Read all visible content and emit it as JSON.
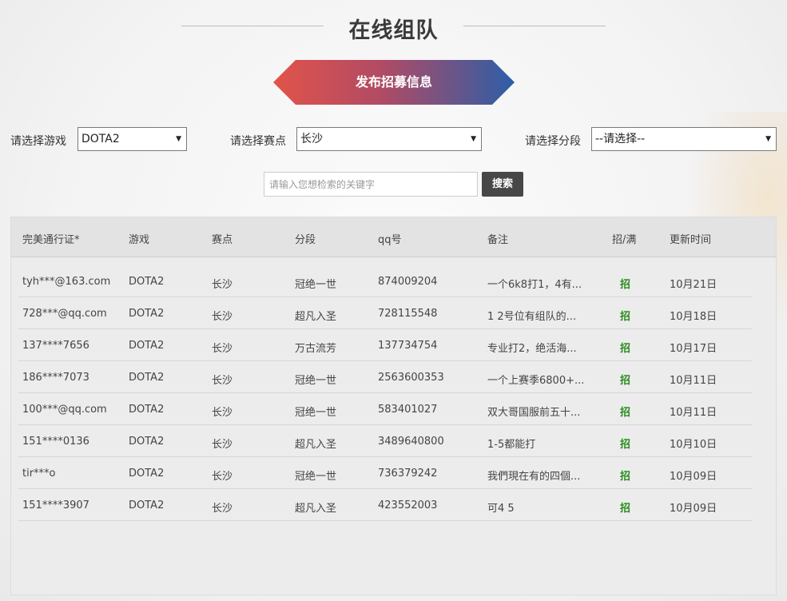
{
  "header": {
    "title": "在线组队"
  },
  "publish_button": {
    "label": "发布招募信息"
  },
  "filters": {
    "game": {
      "label": "请选择游戏",
      "value": "DOTA2"
    },
    "venue": {
      "label": "请选择赛点",
      "value": "长沙"
    },
    "rank": {
      "label": "请选择分段",
      "value": "--请选择--"
    }
  },
  "search": {
    "placeholder": "请输入您想检索的关键字",
    "button_label": "搜索"
  },
  "table": {
    "columns": [
      "完美通行证*",
      "游戏",
      "赛点",
      "分段",
      "qq号",
      "备注",
      "招/满",
      "更新时间"
    ],
    "rows": [
      [
        "tyh***@163.com",
        "DOTA2",
        "长沙",
        "冠绝一世",
        "874009204",
        "一个6k8打1，4有...",
        "招",
        "10月21日"
      ],
      [
        "728***@qq.com",
        "DOTA2",
        "长沙",
        "超凡入圣",
        "728115548",
        "1 2号位有组队的...",
        "招",
        "10月18日"
      ],
      [
        "137****7656",
        "DOTA2",
        "长沙",
        "万古流芳",
        "137734754",
        "专业打2，绝活海...",
        "招",
        "10月17日"
      ],
      [
        "186****7073",
        "DOTA2",
        "长沙",
        "冠绝一世",
        "2563600353",
        "一个上赛季6800+...",
        "招",
        "10月11日"
      ],
      [
        "100***@qq.com",
        "DOTA2",
        "长沙",
        "冠绝一世",
        "583401027",
        "双大哥国服前五十...",
        "招",
        "10月11日"
      ],
      [
        "151****0136",
        "DOTA2",
        "长沙",
        "超凡入圣",
        "3489640800",
        "1-5都能打",
        "招",
        "10月10日"
      ],
      [
        "tir***o",
        "DOTA2",
        "长沙",
        "冠绝一世",
        "736379242",
        "我們現在有的四個...",
        "招",
        "10月09日"
      ],
      [
        "151****3907",
        "DOTA2",
        "长沙",
        "超凡入圣",
        "423552003",
        "可4 5",
        "招",
        "10月09日"
      ]
    ]
  },
  "icons": {
    "select_arrow": "dropdown-arrow-icon"
  },
  "colors": {
    "recruit": "#2b8a1e",
    "button_gradient_start": "#e2534a",
    "button_gradient_end": "#2d5ea8",
    "search_button": "#474747"
  }
}
